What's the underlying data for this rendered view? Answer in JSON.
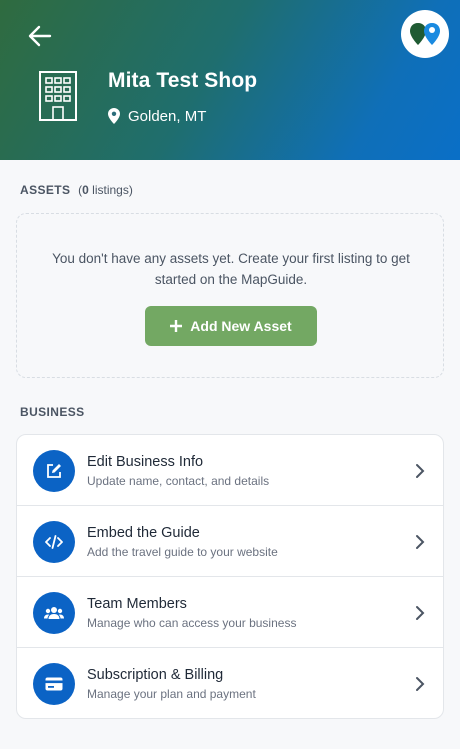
{
  "header": {
    "shop_name": "Mita Test Shop",
    "location": "Golden, MT",
    "gradient_colors": [
      "#2f6b3f",
      "#0a6fc7"
    ]
  },
  "assets": {
    "section_label": "ASSETS",
    "count_open": "(",
    "count_value": "0",
    "count_suffix": " listings)",
    "empty_message": "You don't have any assets yet. Create your first listing to get started on the MapGuide.",
    "add_button_label": "Add New Asset",
    "add_button_color": "#73a863"
  },
  "business": {
    "section_label": "BUSINESS",
    "items": [
      {
        "title": "Edit Business Info",
        "subtitle": "Update name, contact, and details",
        "icon": "edit-icon"
      },
      {
        "title": "Embed the Guide",
        "subtitle": "Add the travel guide to your website",
        "icon": "code-icon"
      },
      {
        "title": "Team Members",
        "subtitle": "Manage who can access your business",
        "icon": "users-icon"
      },
      {
        "title": "Subscription & Billing",
        "subtitle": "Manage your plan and payment",
        "icon": "credit-card-icon"
      }
    ],
    "icon_color": "#0b63c5"
  }
}
